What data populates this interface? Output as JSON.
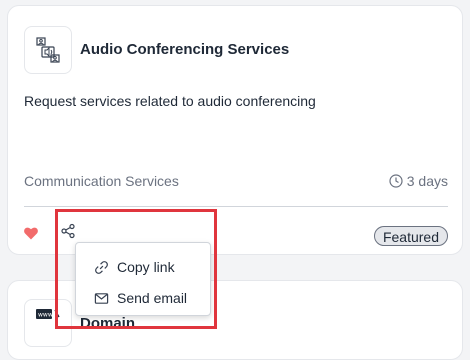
{
  "card": {
    "title": "Audio Conferencing Services",
    "description": "Request services related to audio conferencing",
    "category": "Communication Services",
    "duration": "3 days",
    "badge": "Featured"
  },
  "next_card": {
    "title_partial": "Domain"
  },
  "share_menu": {
    "items": [
      {
        "label": "Copy link",
        "icon": "link-icon"
      },
      {
        "label": "Send email",
        "icon": "mail-icon"
      }
    ]
  },
  "colors": {
    "heart": "#f26b6b",
    "highlight": "#e0353d",
    "badge_bg": "#e5e7eb"
  }
}
